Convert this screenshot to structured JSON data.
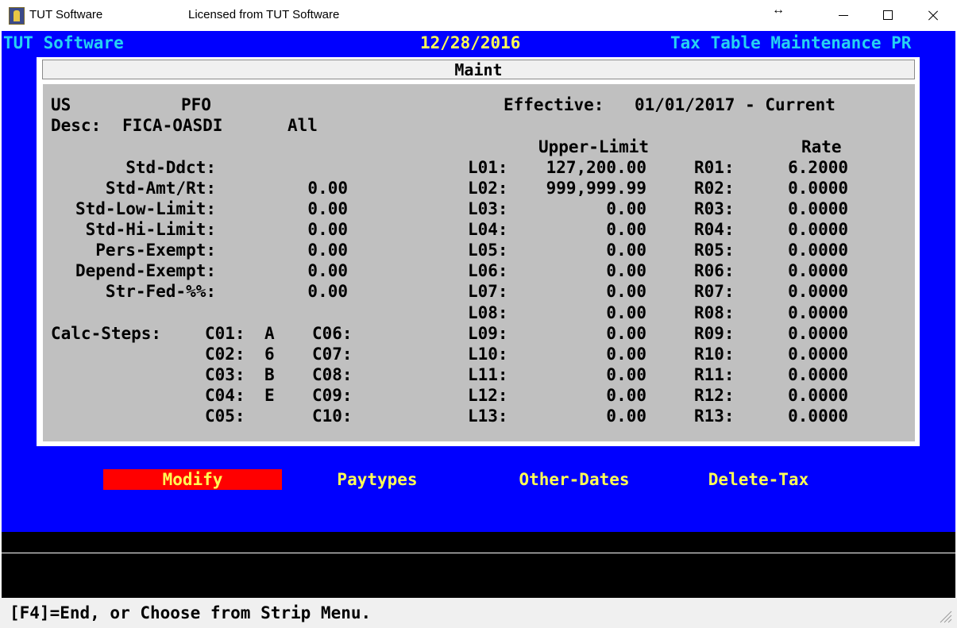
{
  "window": {
    "app_title": "TUT Software",
    "license_text": "Licensed from TUT Software"
  },
  "header": {
    "left": "TUT Software",
    "date": "12/28/2016",
    "right": "Tax Table Maintenance PR"
  },
  "panel_title": "Maint",
  "form": {
    "country": "US",
    "tax_code": "PFO",
    "effective_label": "Effective:",
    "effective_range": "01/01/2017 - Current",
    "desc_label": "Desc:",
    "desc_value": "FICA-OASDI",
    "desc_scope": "All",
    "fields": [
      {
        "label": "Std-Ddct:",
        "value": ""
      },
      {
        "label": "Std-Amt/Rt:",
        "value": "0.00"
      },
      {
        "label": "Std-Low-Limit:",
        "value": "0.00"
      },
      {
        "label": "Std-Hi-Limit:",
        "value": "0.00"
      },
      {
        "label": "Pers-Exempt:",
        "value": "0.00"
      },
      {
        "label": "Depend-Exempt:",
        "value": "0.00"
      },
      {
        "label": "Str-Fed-%%:",
        "value": "0.00"
      }
    ],
    "calc_steps_label": "Calc-Steps:",
    "calc_steps_left": [
      {
        "label": "C01:",
        "value": "A"
      },
      {
        "label": "C02:",
        "value": "6"
      },
      {
        "label": "C03:",
        "value": "B"
      },
      {
        "label": "C04:",
        "value": "E"
      },
      {
        "label": "C05:",
        "value": ""
      }
    ],
    "calc_steps_right": [
      {
        "label": "C06:",
        "value": ""
      },
      {
        "label": "C07:",
        "value": ""
      },
      {
        "label": "C08:",
        "value": ""
      },
      {
        "label": "C09:",
        "value": ""
      },
      {
        "label": "C10:",
        "value": ""
      }
    ],
    "upper_limit_header": "Upper-Limit",
    "rate_header": "Rate",
    "brackets": [
      {
        "l": "L01:",
        "limit": "127,200.00",
        "r": "R01:",
        "rate": "6.2000"
      },
      {
        "l": "L02:",
        "limit": "999,999.99",
        "r": "R02:",
        "rate": "0.0000"
      },
      {
        "l": "L03:",
        "limit": "0.00",
        "r": "R03:",
        "rate": "0.0000"
      },
      {
        "l": "L04:",
        "limit": "0.00",
        "r": "R04:",
        "rate": "0.0000"
      },
      {
        "l": "L05:",
        "limit": "0.00",
        "r": "R05:",
        "rate": "0.0000"
      },
      {
        "l": "L06:",
        "limit": "0.00",
        "r": "R06:",
        "rate": "0.0000"
      },
      {
        "l": "L07:",
        "limit": "0.00",
        "r": "R07:",
        "rate": "0.0000"
      },
      {
        "l": "L08:",
        "limit": "0.00",
        "r": "R08:",
        "rate": "0.0000"
      },
      {
        "l": "L09:",
        "limit": "0.00",
        "r": "R09:",
        "rate": "0.0000"
      },
      {
        "l": "L10:",
        "limit": "0.00",
        "r": "R10:",
        "rate": "0.0000"
      },
      {
        "l": "L11:",
        "limit": "0.00",
        "r": "R11:",
        "rate": "0.0000"
      },
      {
        "l": "L12:",
        "limit": "0.00",
        "r": "R12:",
        "rate": "0.0000"
      },
      {
        "l": "L13:",
        "limit": "0.00",
        "r": "R13:",
        "rate": "0.0000"
      }
    ]
  },
  "menu": {
    "modify": "Modify",
    "paytypes": "Paytypes",
    "other_dates": "Other-Dates",
    "delete_tax": "Delete-Tax"
  },
  "status": {
    "message": "[F4]=End, or Choose from Strip Menu."
  },
  "colors": {
    "terminal_bg": "#0000ff",
    "header_cyan": "#26d2f2",
    "header_yellow": "#ffff55",
    "panel_gray": "#c0c0c0",
    "menu_selected_bg": "#ff0000"
  },
  "icons": [
    "app-logo-icon",
    "resize-arrows-icon",
    "minimize-icon",
    "maximize-icon",
    "close-icon",
    "resize-grip-icon"
  ]
}
